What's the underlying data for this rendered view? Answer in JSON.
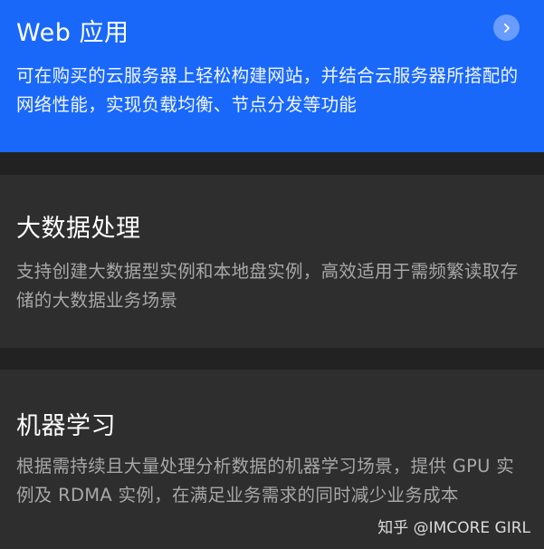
{
  "cards": [
    {
      "title": "Web 应用",
      "description": "可在购买的云服务器上轻松构建网站，并结合云服务器所搭配的网络性能，实现负载均衡、节点分发等功能"
    },
    {
      "title": "大数据处理",
      "description": "支持创建大数据型实例和本地盘实例，高效适用于需频繁读取存储的大数据业务场景"
    },
    {
      "title": "机器学习",
      "description": "根据需持续且大量处理分析数据的机器学习场景，提供 GPU 实例及 RDMA 实例，在满足业务需求的同时减少业务成本"
    }
  ],
  "watermark": "知乎 @IMCORE GIRL",
  "icons": {
    "web_arrow": "chevron-right-icon"
  },
  "colors": {
    "accent": "#1968fa",
    "card_dark": "#2e2e2e",
    "background": "#222222"
  }
}
